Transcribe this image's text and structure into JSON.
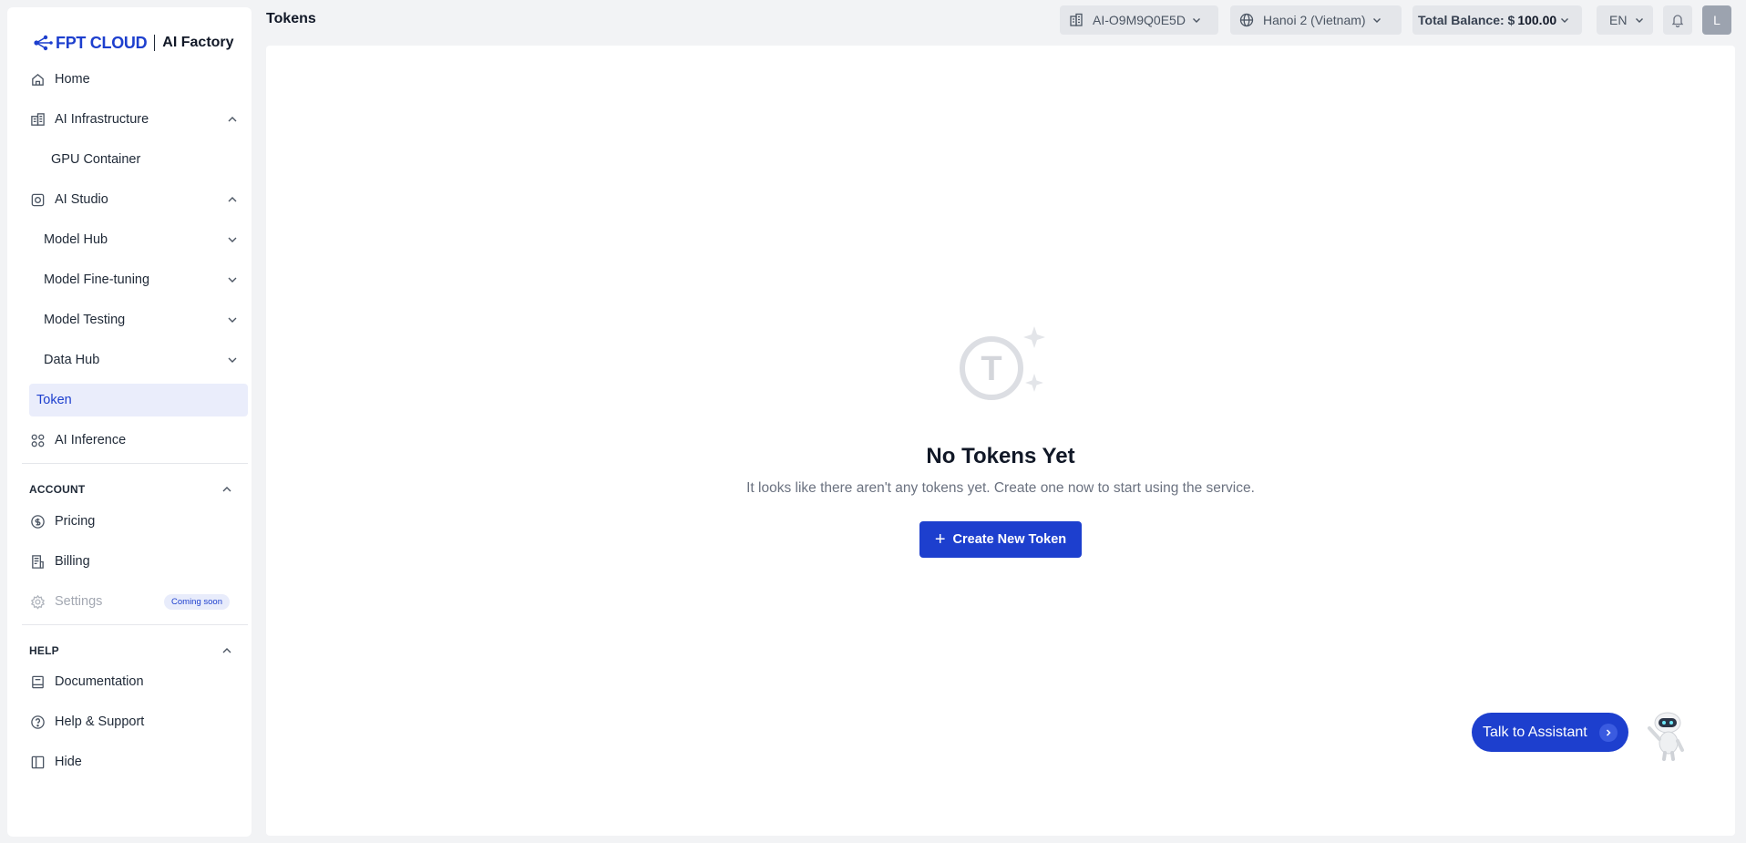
{
  "brand": {
    "name": "FPT CLOUD",
    "product": "AI Factory",
    "color": "#1d3fce"
  },
  "sidebar": {
    "home": "Home",
    "ai_infrastructure": "AI Infrastructure",
    "gpu_container": "GPU Container",
    "ai_studio": "AI Studio",
    "model_hub": "Model Hub",
    "model_fine_tuning": "Model Fine-tuning",
    "model_testing": "Model Testing",
    "data_hub": "Data Hub",
    "token": "Token",
    "ai_inference": "AI Inference",
    "account_section": "ACCOUNT",
    "pricing": "Pricing",
    "billing": "Billing",
    "settings": "Settings",
    "settings_badge": "Coming soon",
    "help_section": "HELP",
    "documentation": "Documentation",
    "help_support": "Help & Support",
    "hide": "Hide"
  },
  "header": {
    "title": "Tokens",
    "tenant": "AI-O9M9Q0E5D",
    "region": "Hanoi 2 (Vietnam)",
    "balance_label": "Total Balance: $",
    "balance_value": "100.00",
    "language": "EN",
    "avatar_initial": "L"
  },
  "empty_state": {
    "title": "No Tokens Yet",
    "description": "It looks like there aren't any tokens yet. Create one now to start using the service.",
    "button": "Create New Token"
  },
  "assistant": {
    "label": "Talk to Assistant"
  }
}
